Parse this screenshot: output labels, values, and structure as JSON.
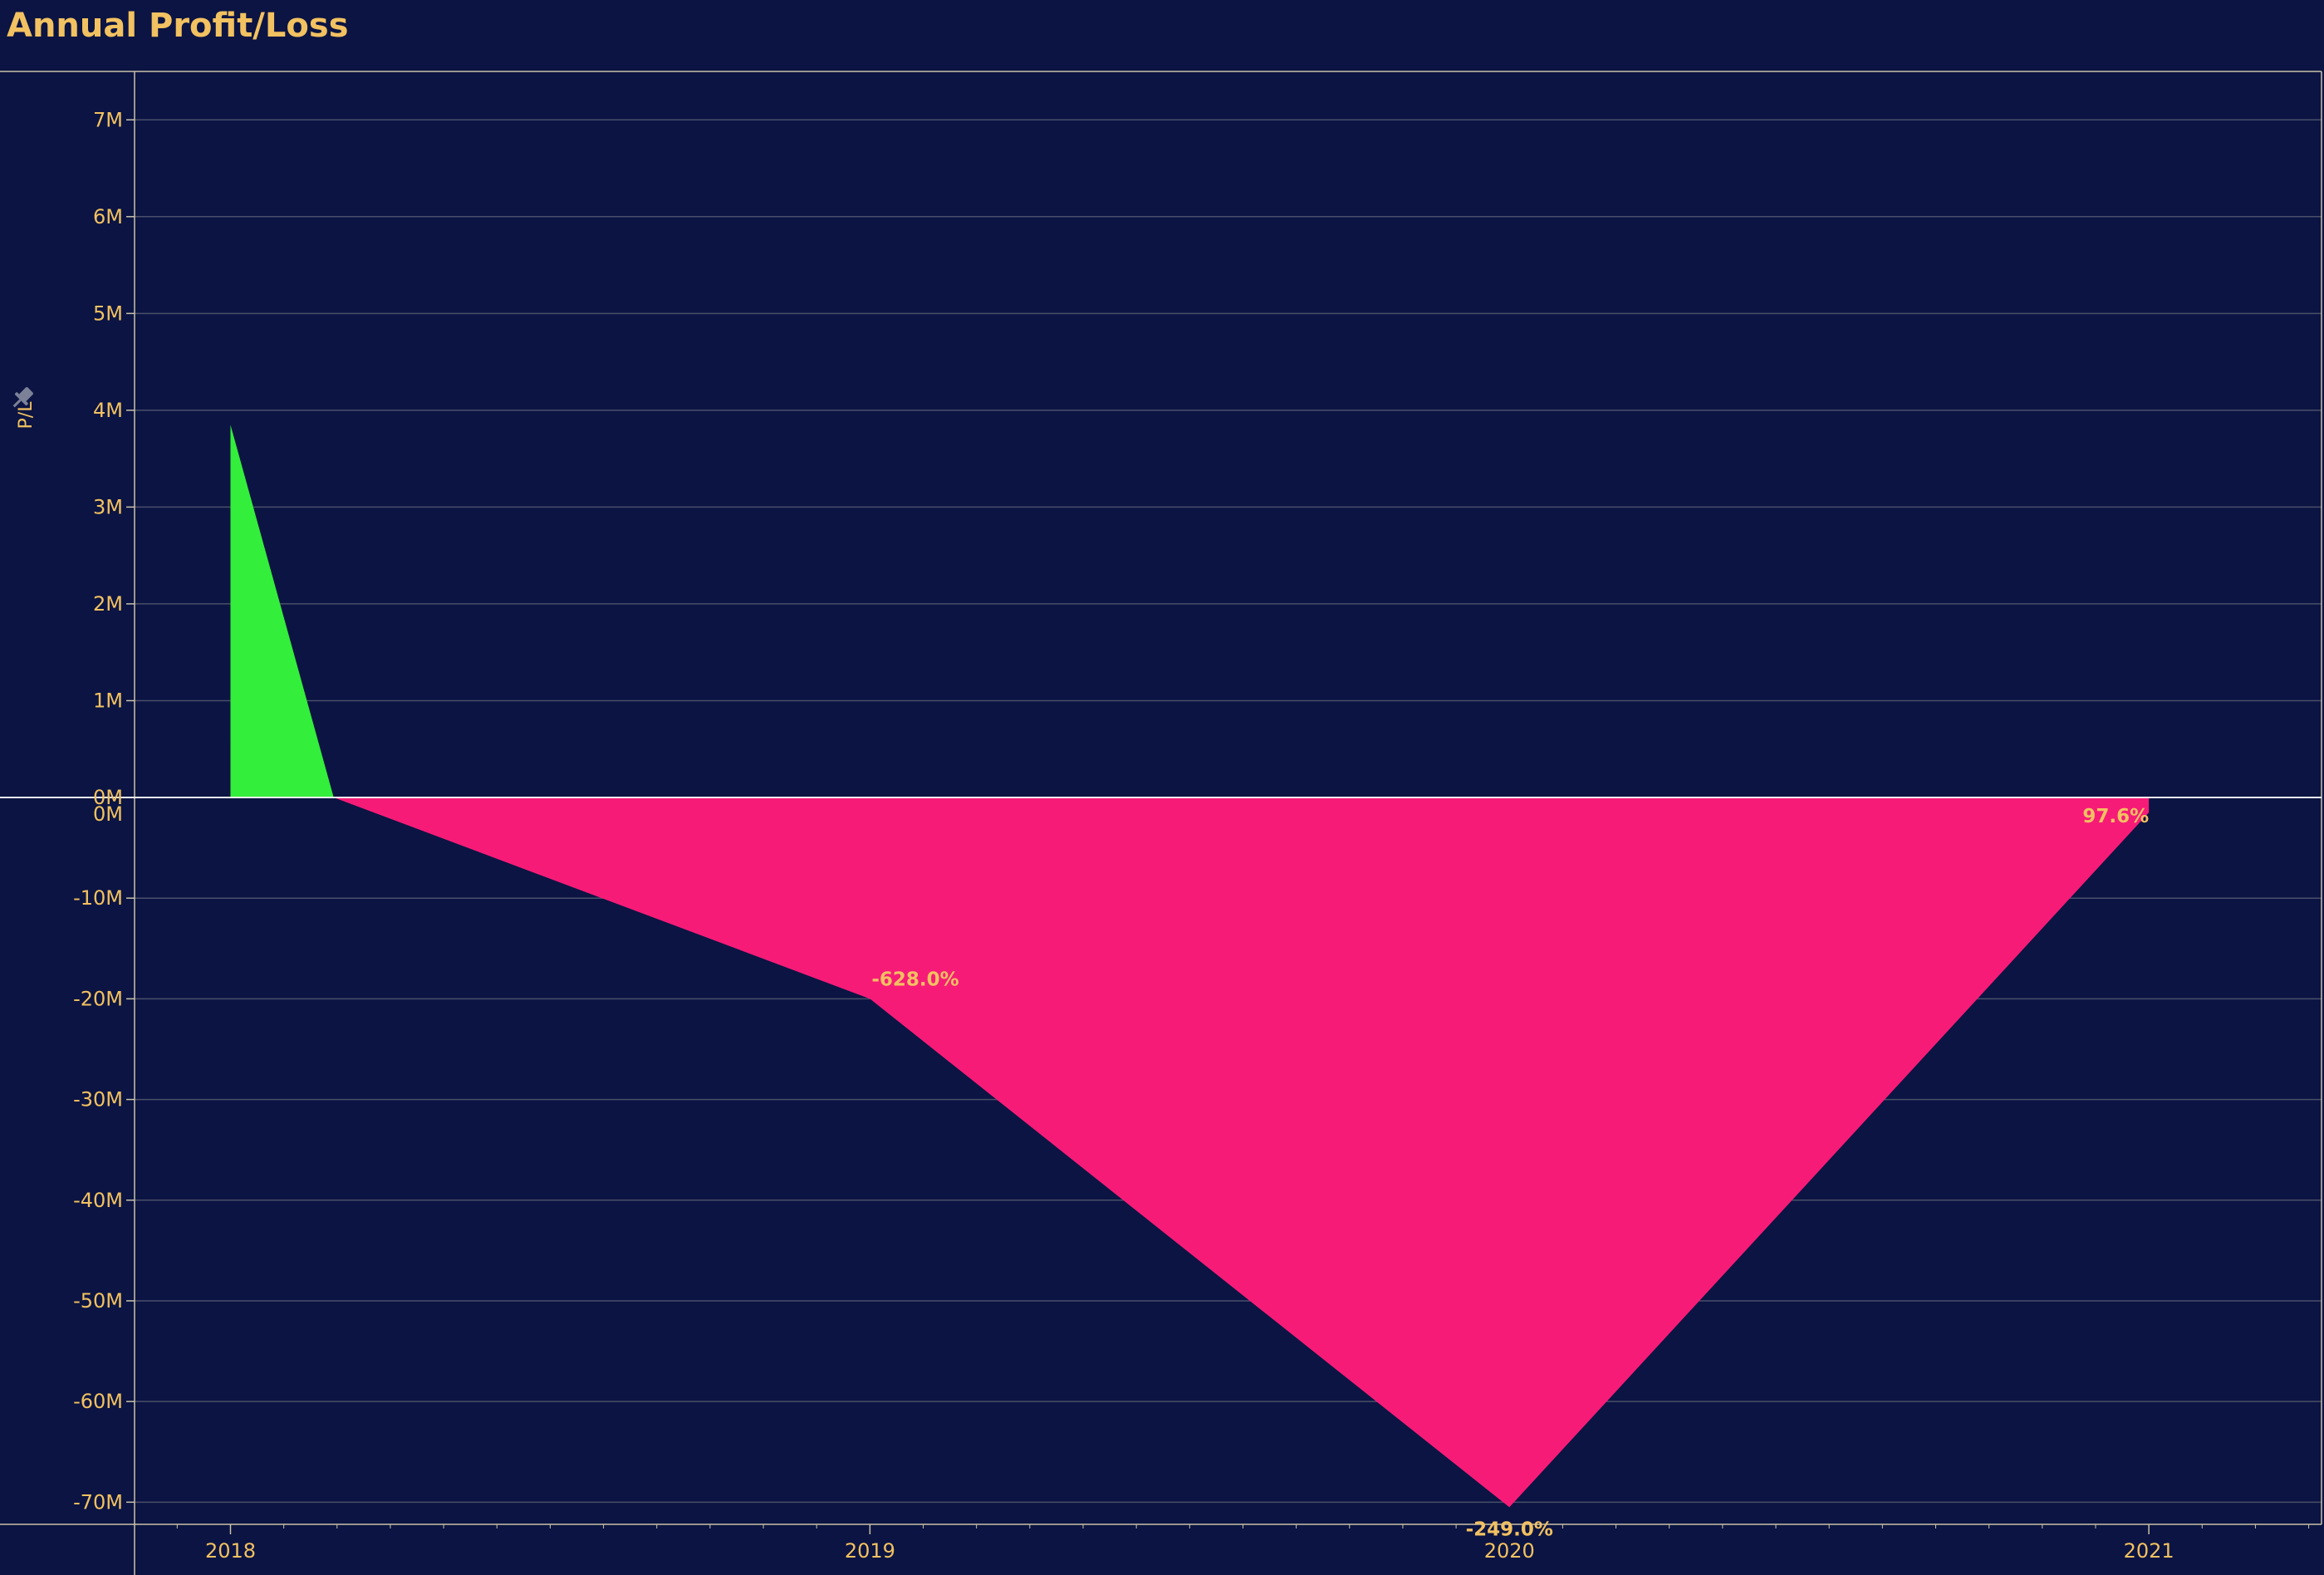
{
  "title": "Annual Profit/Loss",
  "colors": {
    "background": "#0b1442",
    "label": "#f2c161",
    "grid": "#4a4f6a",
    "profit": "#33ee3a",
    "loss": "#f71b78",
    "axis": "#c9c2a8",
    "pin_icon": "#7b8197"
  },
  "chart_data": {
    "type": "area",
    "title": "Annual Profit/Loss",
    "ylabel": "P/L",
    "xlabel": "",
    "x_ticks": [
      "2018",
      "2019",
      "2020",
      "2021"
    ],
    "upper_panel": {
      "ylim": [
        0,
        7000000
      ],
      "y_ticks": [
        "0M",
        "1M",
        "2M",
        "3M",
        "4M",
        "5M",
        "6M",
        "7M"
      ],
      "y_tick_values": [
        0,
        1000000,
        2000000,
        3000000,
        4000000,
        5000000,
        6000000,
        7000000
      ]
    },
    "lower_panel": {
      "ylim": [
        -72000000,
        0
      ],
      "y_ticks": [
        "0M",
        "-10M",
        "-20M",
        "-30M",
        "-40M",
        "-50M",
        "-60M",
        "-70M"
      ],
      "y_tick_values": [
        0,
        -10000000,
        -20000000,
        -30000000,
        -40000000,
        -50000000,
        -60000000,
        -70000000
      ]
    },
    "series": [
      {
        "x": [
          2018.0,
          2019.0,
          2020.0,
          2021.0
        ],
        "values": [
          3850000,
          -20000000,
          -70500000,
          -1500000
        ]
      }
    ],
    "data_labels": [
      {
        "x": 2019.0,
        "text": "-628.0%"
      },
      {
        "x": 2020.0,
        "text": "-249.0%"
      },
      {
        "x": 2021.0,
        "text": "97.6%"
      }
    ],
    "grid": true,
    "legend": "none"
  }
}
